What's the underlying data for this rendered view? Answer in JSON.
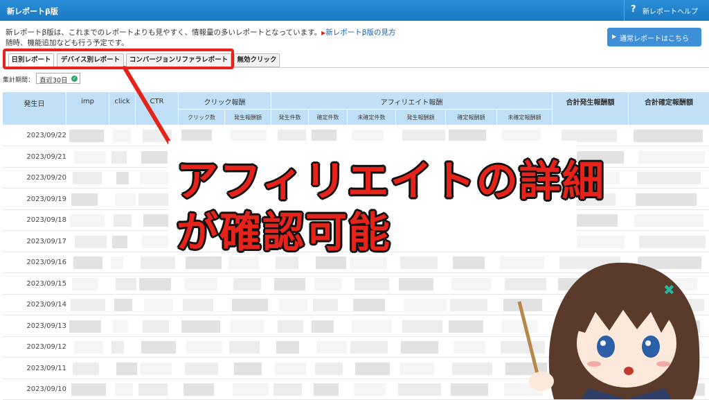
{
  "topbar": {
    "title": "新レポートβ版",
    "help_icon": "?",
    "help_label": "新レポートヘルプ"
  },
  "intro": {
    "line1": "新レポートβ版は、これまでのレポートよりも見やすく、情報量の多いレポートとなっています。",
    "link": "新レポートβ版の見方",
    "line2": "随時、機能追加なども行う予定です。"
  },
  "old_report_button": "通常レポートはこちら",
  "tabs": [
    {
      "label": "日別レポート",
      "active": true
    },
    {
      "label": "デバイス別レポート",
      "active": false
    },
    {
      "label": "コンバージョンリファラレポート",
      "active": false
    },
    {
      "label": "無効クリック",
      "active": false
    }
  ],
  "period": {
    "label": "集計期間：",
    "value": "直近30日"
  },
  "table": {
    "headers": {
      "date": "発生日",
      "imp": "imp",
      "click": "click",
      "ctr": "CTR",
      "click_reward": "クリック報酬",
      "affiliate_reward": "アフィリエイト報酬",
      "total_occurred": "合計発生報酬額",
      "total_confirmed": "合計確定報酬額"
    },
    "sub_headers": {
      "click_count": "クリック数",
      "occurred_amount": "発生報酬額",
      "occurred_count": "発生件数",
      "confirmed_count": "確定件数",
      "unconfirmed_count": "未確定件数",
      "aff_occurred_amount": "発生報酬額",
      "confirmed_amount": "確定報酬額",
      "unconfirmed_amount": "未確定報酬額"
    },
    "rows": [
      "2023/09/22",
      "2023/09/21",
      "2023/09/20",
      "2023/09/19",
      "2023/09/18",
      "2023/09/17",
      "2023/09/16",
      "2023/09/15",
      "2023/09/14",
      "2023/09/13",
      "2023/09/12",
      "2023/09/11",
      "2023/09/10"
    ]
  },
  "annotation": {
    "line1": "アフィリエイトの詳細",
    "line2": "が確認可能"
  },
  "colors": {
    "accent": "#1a78c2",
    "header_bg": "#bfe0f7",
    "highlight": "#e5231b"
  }
}
